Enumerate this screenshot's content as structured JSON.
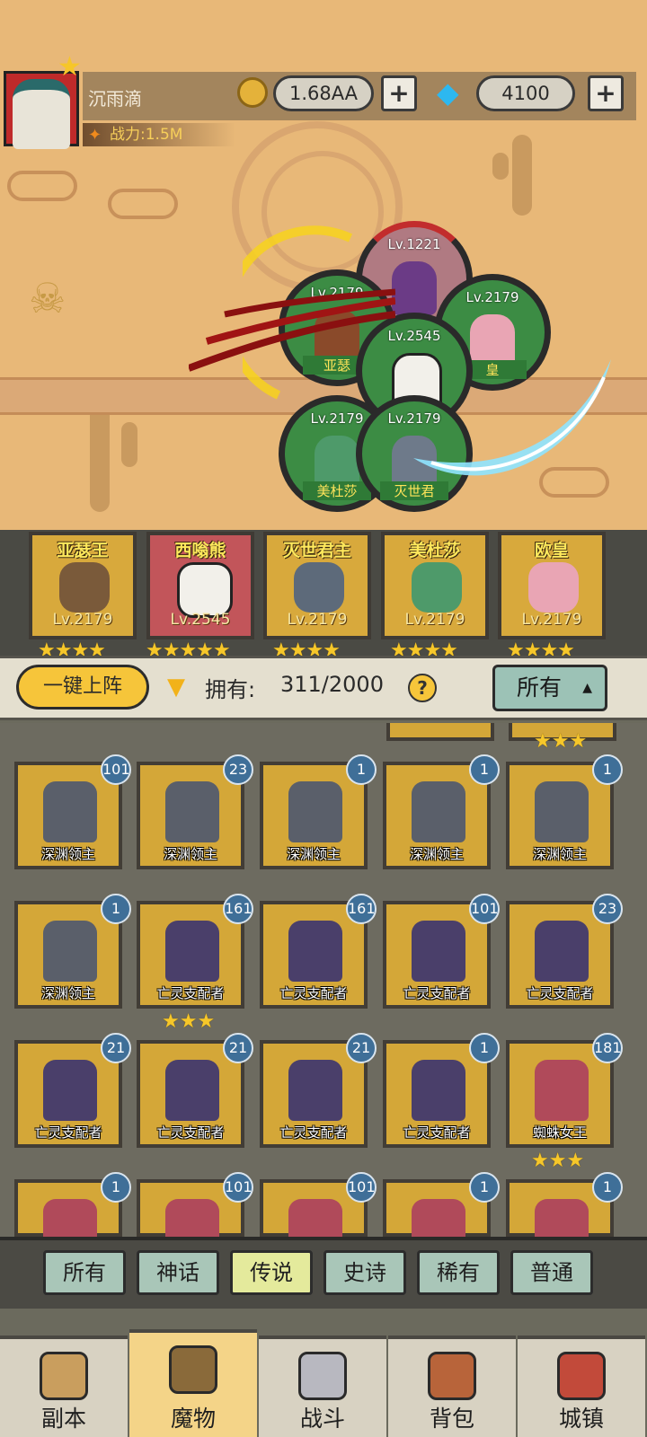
{
  "player": {
    "name": "沉雨滴",
    "power": "战力:1.5M"
  },
  "resources": {
    "gold": "1.68AA",
    "gems": "4100",
    "plus": "+"
  },
  "battle_orbs": [
    {
      "level": "Lv.1221",
      "name": ""
    },
    {
      "level": "Lv.2179",
      "name": "亚瑟"
    },
    {
      "level": "Lv.2179",
      "name": "皇"
    },
    {
      "level": "Lv.2545",
      "name": ""
    },
    {
      "level": "Lv.2179",
      "name": "美杜莎"
    },
    {
      "level": "Lv.2179",
      "name": "灭世君"
    }
  ],
  "lineup": [
    {
      "name": "亚瑟王",
      "level": "Lv.2179",
      "stars": "★★★★"
    },
    {
      "name": "西嗡熊",
      "level": "Lv.2545",
      "stars": "★★★★★"
    },
    {
      "name": "灭世君主",
      "level": "Lv.2179",
      "stars": "★★★★"
    },
    {
      "name": "美杜莎",
      "level": "Lv.2179",
      "stars": "★★★★"
    },
    {
      "name": "欧皇",
      "level": "Lv.2179",
      "stars": "★★★★"
    }
  ],
  "filter": {
    "deploy": "一键上阵",
    "owned_label": "拥有:",
    "owned": "311/2000",
    "help": "?",
    "dropdown": "所有",
    "caret": "▲"
  },
  "grid_partial_stars": "★★★",
  "grid": [
    {
      "name": "深渊领主",
      "count": "101",
      "stars": ""
    },
    {
      "name": "深渊领主",
      "count": "23",
      "stars": ""
    },
    {
      "name": "深渊领主",
      "count": "1",
      "stars": ""
    },
    {
      "name": "深渊领主",
      "count": "1",
      "stars": ""
    },
    {
      "name": "深渊领主",
      "count": "1",
      "stars": ""
    },
    {
      "name": "深渊领主",
      "count": "1",
      "stars": ""
    },
    {
      "name": "亡灵支配者",
      "count": "161",
      "stars": "★★★"
    },
    {
      "name": "亡灵支配者",
      "count": "161",
      "stars": ""
    },
    {
      "name": "亡灵支配者",
      "count": "101",
      "stars": ""
    },
    {
      "name": "亡灵支配者",
      "count": "23",
      "stars": ""
    },
    {
      "name": "亡灵支配者",
      "count": "21",
      "stars": ""
    },
    {
      "name": "亡灵支配者",
      "count": "21",
      "stars": ""
    },
    {
      "name": "亡灵支配者",
      "count": "21",
      "stars": ""
    },
    {
      "name": "亡灵支配者",
      "count": "1",
      "stars": ""
    },
    {
      "name": "蜘蛛女王",
      "count": "181",
      "stars": "★★★"
    },
    {
      "name": "",
      "count": "1",
      "stars": ""
    },
    {
      "name": "",
      "count": "101",
      "stars": ""
    },
    {
      "name": "",
      "count": "101",
      "stars": ""
    },
    {
      "name": "",
      "count": "1",
      "stars": ""
    },
    {
      "name": "",
      "count": "1",
      "stars": ""
    }
  ],
  "rarity_tabs": [
    "所有",
    "神话",
    "传说",
    "史诗",
    "稀有",
    "普通"
  ],
  "active_rarity": 2,
  "nav": [
    "副本",
    "魔物",
    "战斗",
    "背包",
    "城镇"
  ],
  "active_nav": 1,
  "colors": {
    "card_gold": "#d4a738",
    "count_badge": "#3f6f98",
    "orb_green": "#3c8c44",
    "tab_active": "#e4ea9c",
    "nav_active": "#f4d488"
  }
}
